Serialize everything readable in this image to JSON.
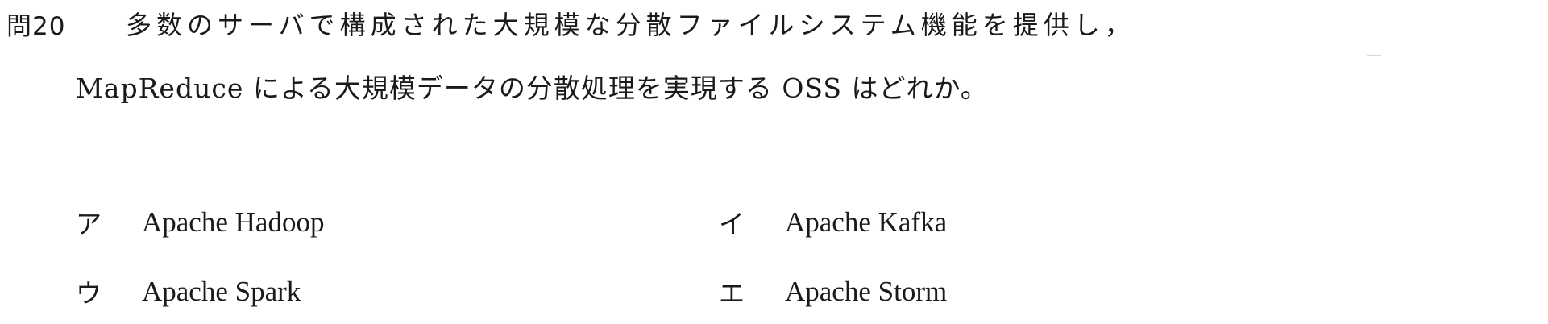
{
  "question": {
    "number": "問20",
    "line1": "多数のサーバで構成された大規模な分散ファイルシステム機能を提供し，",
    "line2": "MapReduce による大規模データの分散処理を実現する OSS はどれか。"
  },
  "choices": [
    {
      "marker": "ア",
      "text": "Apache Hadoop"
    },
    {
      "marker": "イ",
      "text": "Apache Kafka"
    },
    {
      "marker": "ウ",
      "text": "Apache Spark"
    },
    {
      "marker": "エ",
      "text": "Apache Storm"
    }
  ]
}
